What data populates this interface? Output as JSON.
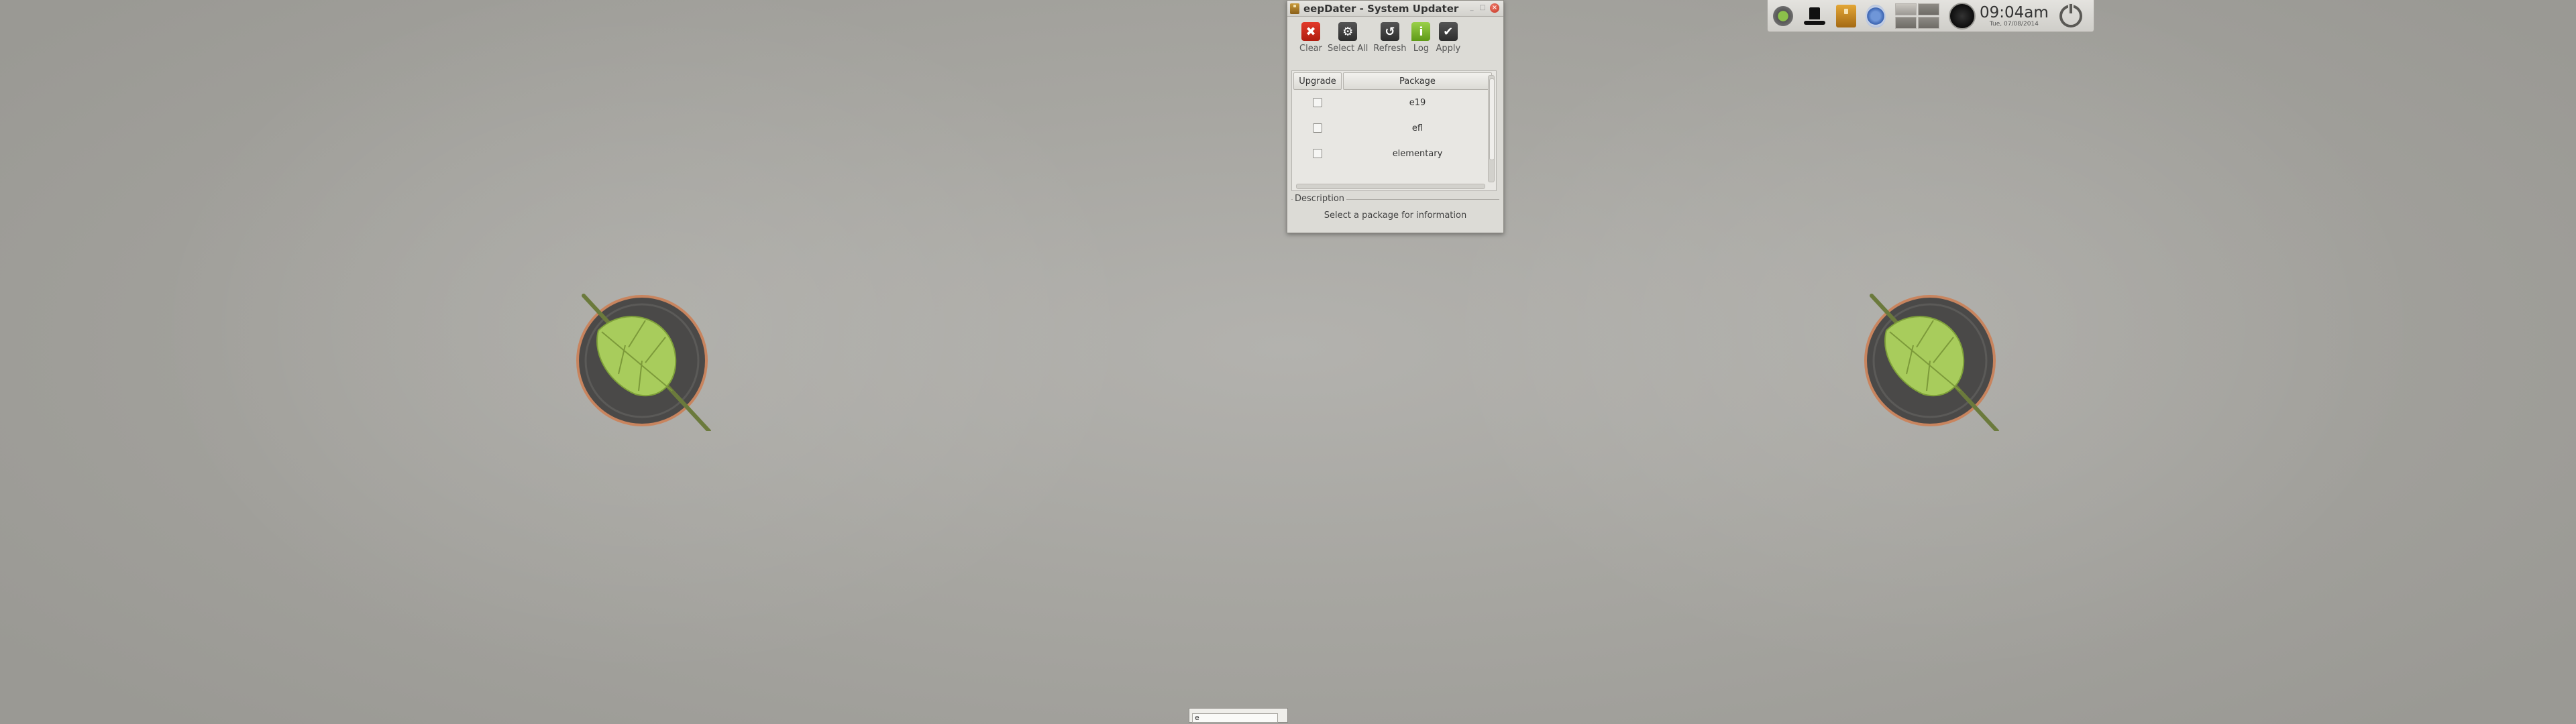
{
  "window": {
    "title": "eepDater - System Updater",
    "controls": {
      "minimize": "_",
      "maximize": "□",
      "close": "×"
    }
  },
  "toolbar": [
    {
      "label": "Clear",
      "icon": "clear-x-icon"
    },
    {
      "label": "Select All",
      "icon": "gear-icon"
    },
    {
      "label": "Refresh",
      "icon": "refresh-icon"
    },
    {
      "label": "Log",
      "icon": "info-icon"
    },
    {
      "label": "Apply",
      "icon": "checkmark-icon"
    }
  ],
  "table": {
    "headers": {
      "upgrade": "Upgrade",
      "package": "Package"
    },
    "rows": [
      {
        "package": "e19",
        "checked": false
      },
      {
        "package": "efl",
        "checked": false
      },
      {
        "package": "elementary",
        "checked": false
      }
    ]
  },
  "description": {
    "legend": "Description",
    "text": "Select a package for information"
  },
  "tray": {
    "clock_time": "09:04am",
    "clock_date": "Tue, 07/08/2014",
    "icons": [
      "leaf-icon",
      "hat-icon",
      "package-icon",
      "shield-icon",
      "pager-icon",
      "moon-icon",
      "power-icon"
    ]
  },
  "bottom_entry": {
    "value": "e"
  },
  "colors": {
    "desktop_bg": "#a7a6a1",
    "clear_icon": "#d22c1d",
    "log_icon": "#7ab533"
  }
}
